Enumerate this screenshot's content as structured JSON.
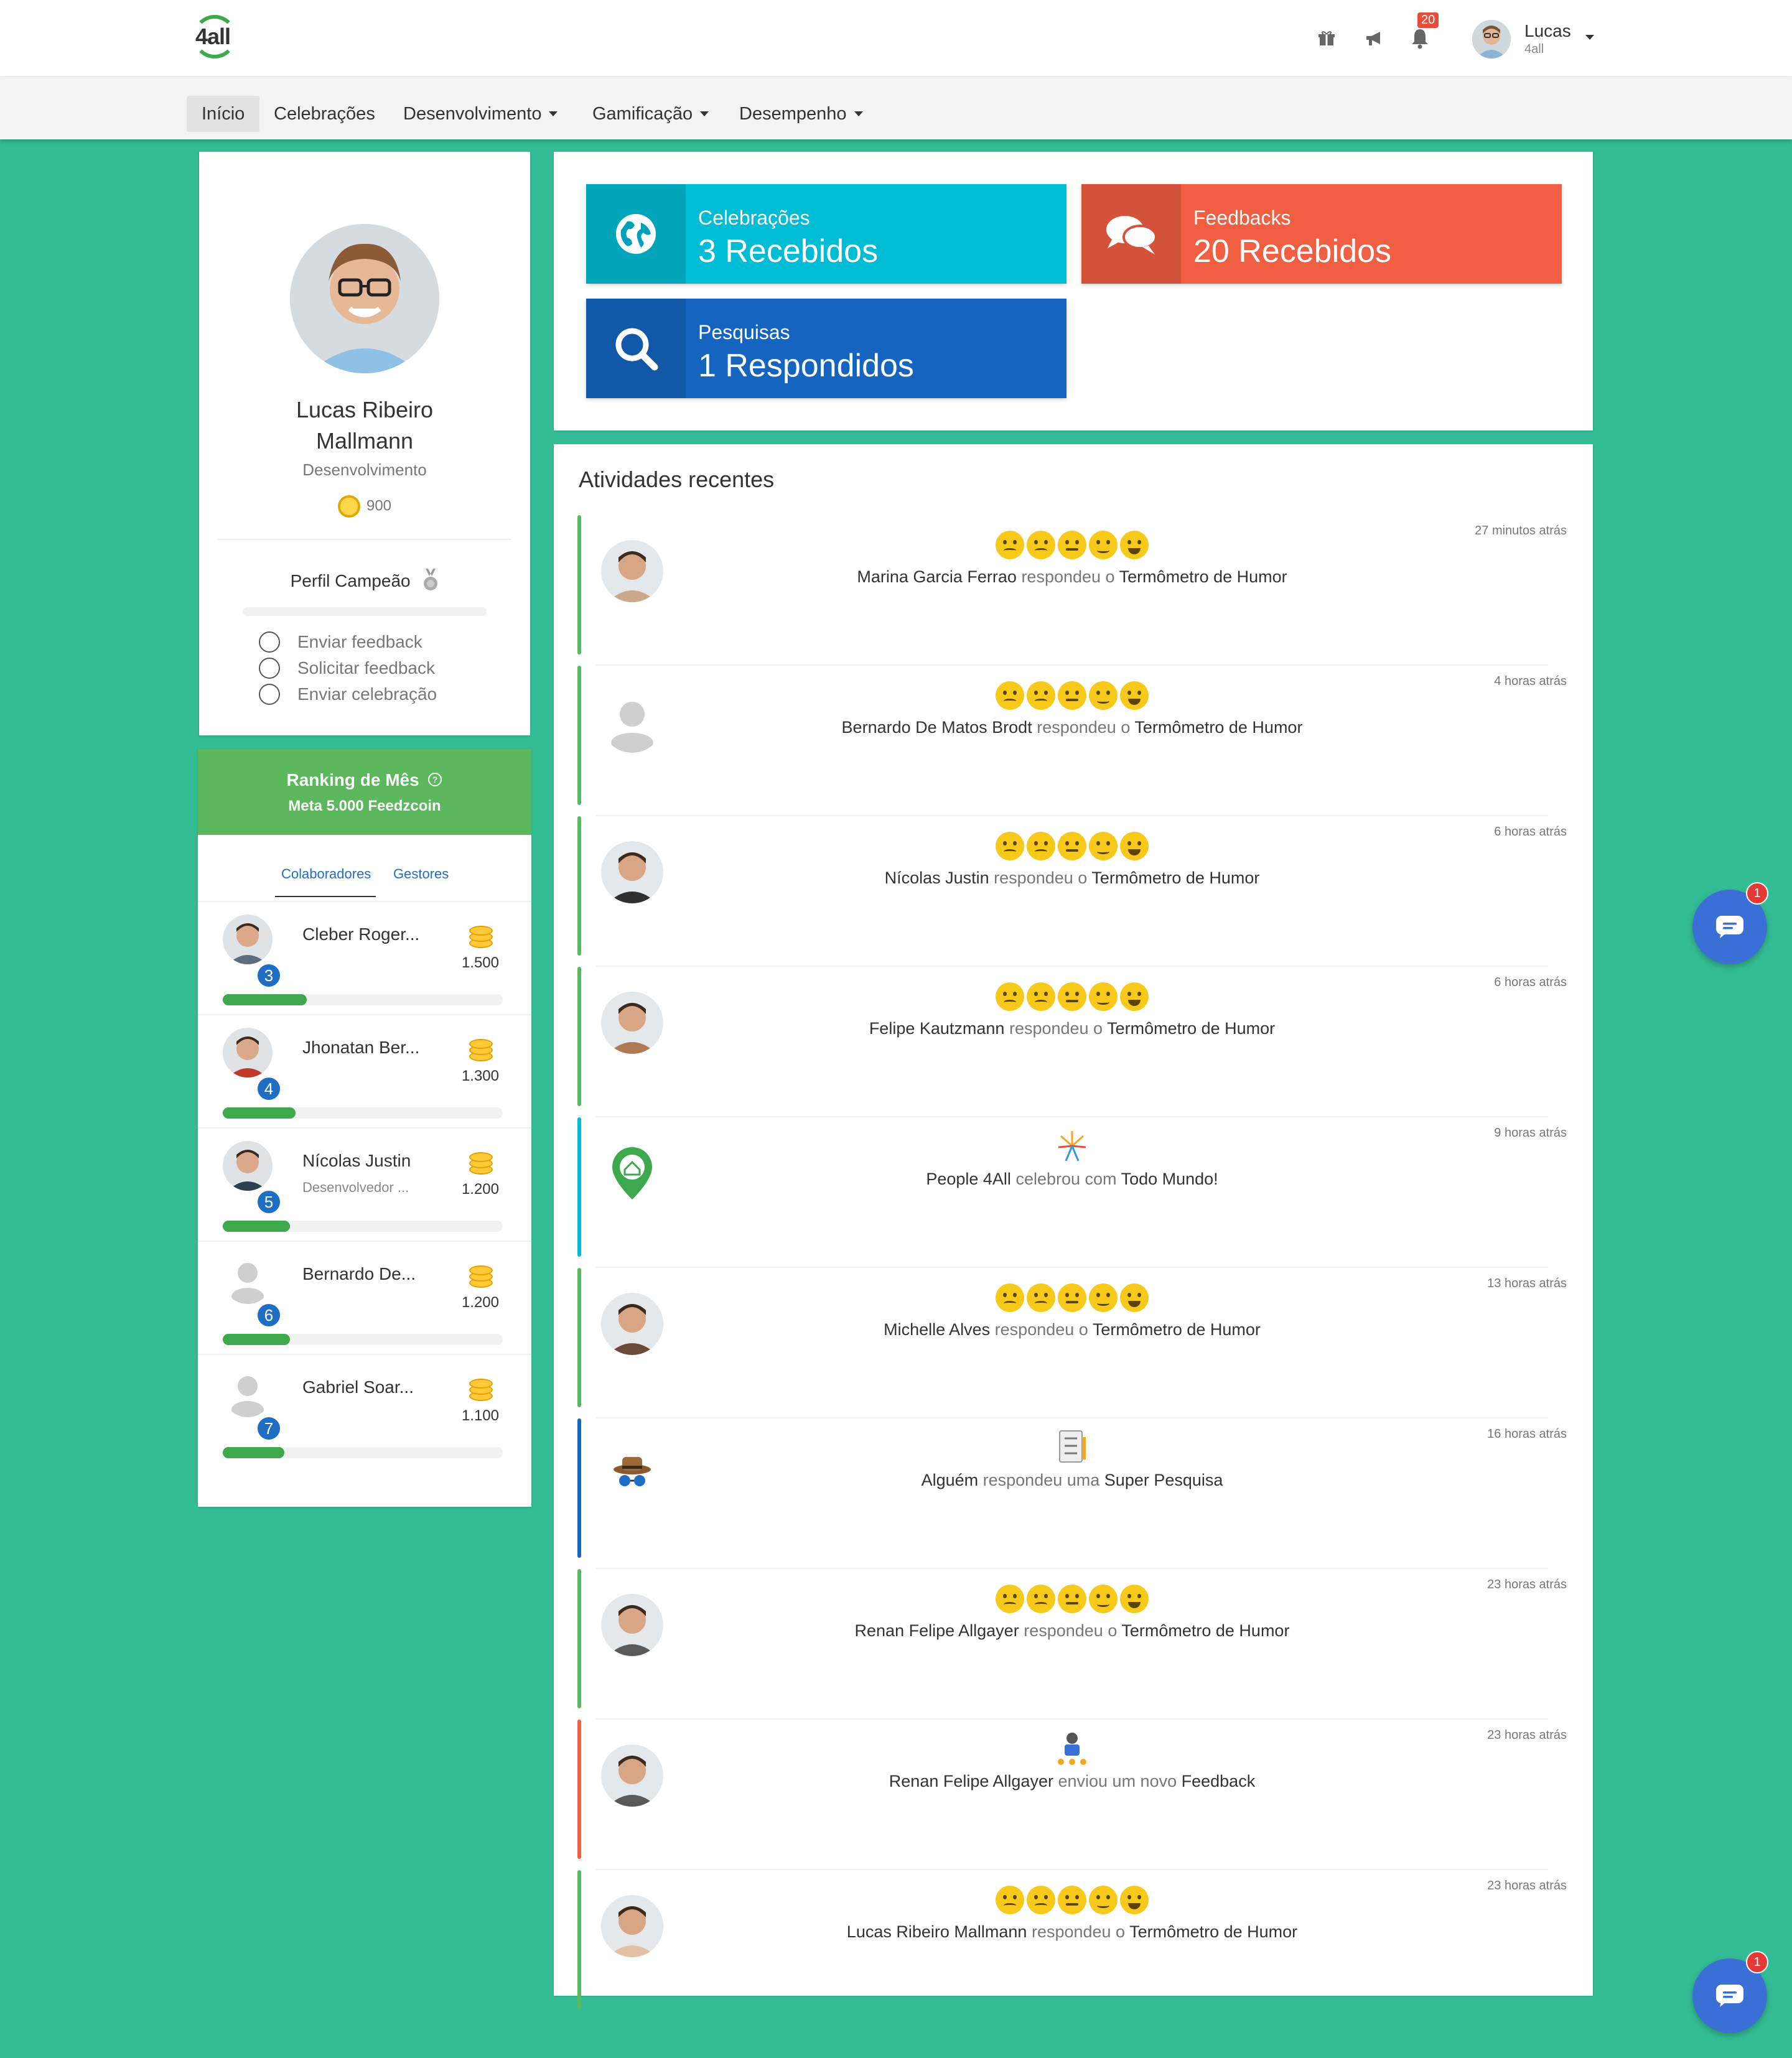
{
  "header": {
    "logo_text": "4all",
    "notifications_count": "20",
    "user_name": "Lucas",
    "user_org": "4all",
    "icons": [
      "gift-icon",
      "megaphone-icon",
      "bell-icon"
    ]
  },
  "nav": {
    "items": [
      {
        "label": "Início",
        "active": true,
        "dropdown": false
      },
      {
        "label": "Celebrações",
        "active": false,
        "dropdown": false
      },
      {
        "label": "Desenvolvimento",
        "active": false,
        "dropdown": true
      },
      {
        "label": "Gamificação",
        "active": false,
        "dropdown": true
      },
      {
        "label": "Desempenho",
        "active": false,
        "dropdown": true
      }
    ]
  },
  "profile": {
    "name_line1": "Lucas Ribeiro",
    "name_line2": "Mallmann",
    "department": "Desenvolvimento",
    "coins": "900",
    "champion_title": "Perfil Campeão",
    "champion_progress": 0,
    "tasks": [
      "Enviar feedback",
      "Solicitar feedback",
      "Enviar celebração"
    ]
  },
  "ranking": {
    "title": "Ranking de Mês",
    "subtitle": "Meta 5.000 Feedzcoin",
    "tabs": [
      "Colaboradores",
      "Gestores"
    ],
    "rows": [
      {
        "position": "3",
        "name": "Cleber Roger...",
        "role": "",
        "coins": "1.500",
        "progress": 0.3
      },
      {
        "position": "4",
        "name": "Jhonatan Ber...",
        "role": "",
        "coins": "1.300",
        "progress": 0.26
      },
      {
        "position": "5",
        "name": "Nícolas Justin",
        "role": "Desenvolvedor ...",
        "coins": "1.200",
        "progress": 0.24
      },
      {
        "position": "6",
        "name": "Bernardo De...",
        "role": "",
        "coins": "1.200",
        "progress": 0.24
      },
      {
        "position": "7",
        "name": "Gabriel Soar...",
        "role": "",
        "coins": "1.100",
        "progress": 0.22
      }
    ]
  },
  "stats": [
    {
      "label": "Celebrações",
      "value": "3 Recebidos",
      "color": "#00bcd4",
      "icon": "globe-icon"
    },
    {
      "label": "Feedbacks",
      "value": "20 Recebidos",
      "color": "#f15f43",
      "icon": "comments-icon"
    },
    {
      "label": "Pesquisas",
      "value": "1 Respondidos",
      "color": "#1565c0",
      "icon": "search-icon"
    }
  ],
  "activities": {
    "title": "Atividades recentes",
    "items": [
      {
        "time": "27 minutos atrás",
        "actor": "Marina Garcia Ferrao",
        "verb": "respondeu o",
        "object": "Termômetro de Humor",
        "kind": "mood",
        "stripe": "#5cb85c"
      },
      {
        "time": "4 horas atrás",
        "actor": "Bernardo De Matos Brodt",
        "verb": "respondeu o",
        "object": "Termômetro de Humor",
        "kind": "mood",
        "stripe": "#5cb85c"
      },
      {
        "time": "6 horas atrás",
        "actor": "Nícolas Justin",
        "verb": "respondeu o",
        "object": "Termômetro de Humor",
        "kind": "mood",
        "stripe": "#5cb85c"
      },
      {
        "time": "6 horas atrás",
        "actor": "Felipe Kautzmann",
        "verb": "respondeu o",
        "object": "Termômetro de Humor",
        "kind": "mood",
        "stripe": "#5cb85c"
      },
      {
        "time": "9 horas atrás",
        "actor": "People 4All",
        "verb": "celebrou com",
        "object": "Todo Mundo!",
        "kind": "celebration",
        "stripe": "#00bcd4"
      },
      {
        "time": "13 horas atrás",
        "actor": "Michelle Alves",
        "verb": "respondeu o",
        "object": "Termômetro de Humor",
        "kind": "mood",
        "stripe": "#5cb85c"
      },
      {
        "time": "16 horas atrás",
        "actor": "Alguém",
        "verb": "respondeu uma",
        "object": "Super Pesquisa",
        "kind": "survey",
        "stripe": "#1565c0"
      },
      {
        "time": "23 horas atrás",
        "actor": "Renan Felipe Allgayer",
        "verb": "respondeu o",
        "object": "Termômetro de Humor",
        "kind": "mood",
        "stripe": "#5cb85c"
      },
      {
        "time": "23 horas atrás",
        "actor": "Renan Felipe Allgayer",
        "verb": "enviou um novo",
        "object": "Feedback",
        "kind": "feedback",
        "stripe": "#f15f43"
      },
      {
        "time": "23 horas atrás",
        "actor": "Lucas Ribeiro Mallmann",
        "verb": "respondeu o",
        "object": "Termômetro de Humor",
        "kind": "mood",
        "stripe": "#5cb85c"
      }
    ]
  },
  "chat": {
    "badge": "1"
  }
}
